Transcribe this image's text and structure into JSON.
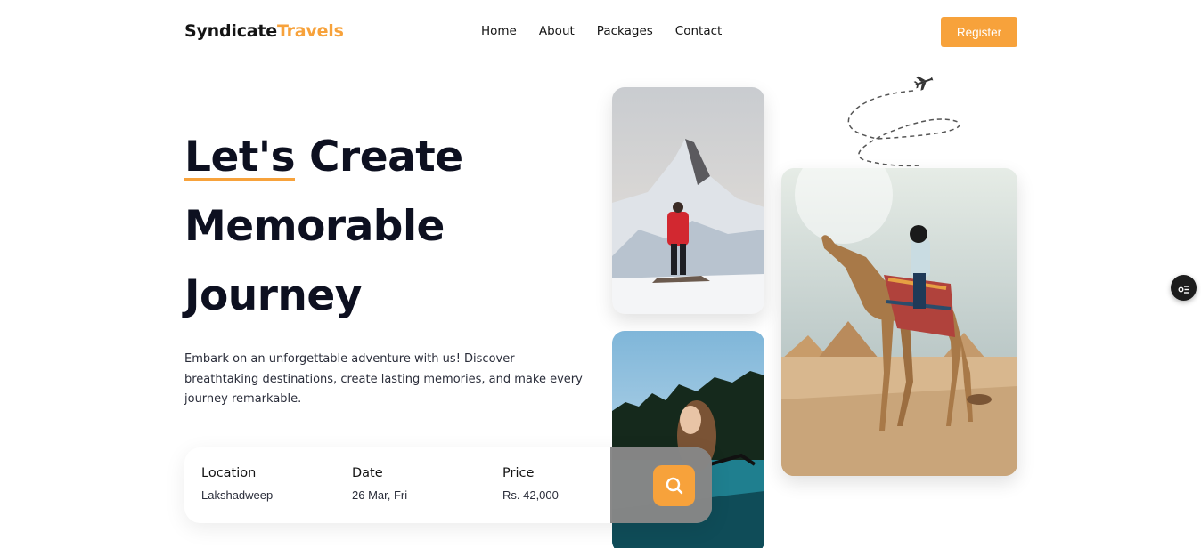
{
  "header": {
    "brand_part1": "Syndicate",
    "brand_part2": "Travels",
    "nav": [
      "Home",
      "About",
      "Packages",
      "Contact"
    ],
    "register_label": "Register"
  },
  "hero": {
    "title_word1": "Let's",
    "title_rest_line1": " Create",
    "title_line2": "Memorable",
    "title_line3": "Journey",
    "description": "Embark on an unforgettable adventure with us! Discover breathtaking destinations, create lasting memories, and make every journey remarkable."
  },
  "search": {
    "location_label": "Location",
    "location_value": "Lakshadweep",
    "date_label": "Date",
    "date_value": "26 Mar, Fri",
    "price_label": "Price",
    "price_value": "Rs. 42,000"
  },
  "colors": {
    "accent": "#f7a23b",
    "text_dark": "#0d1020"
  },
  "icons": [
    "airplane-icon",
    "search-icon",
    "list-settings-icon"
  ]
}
